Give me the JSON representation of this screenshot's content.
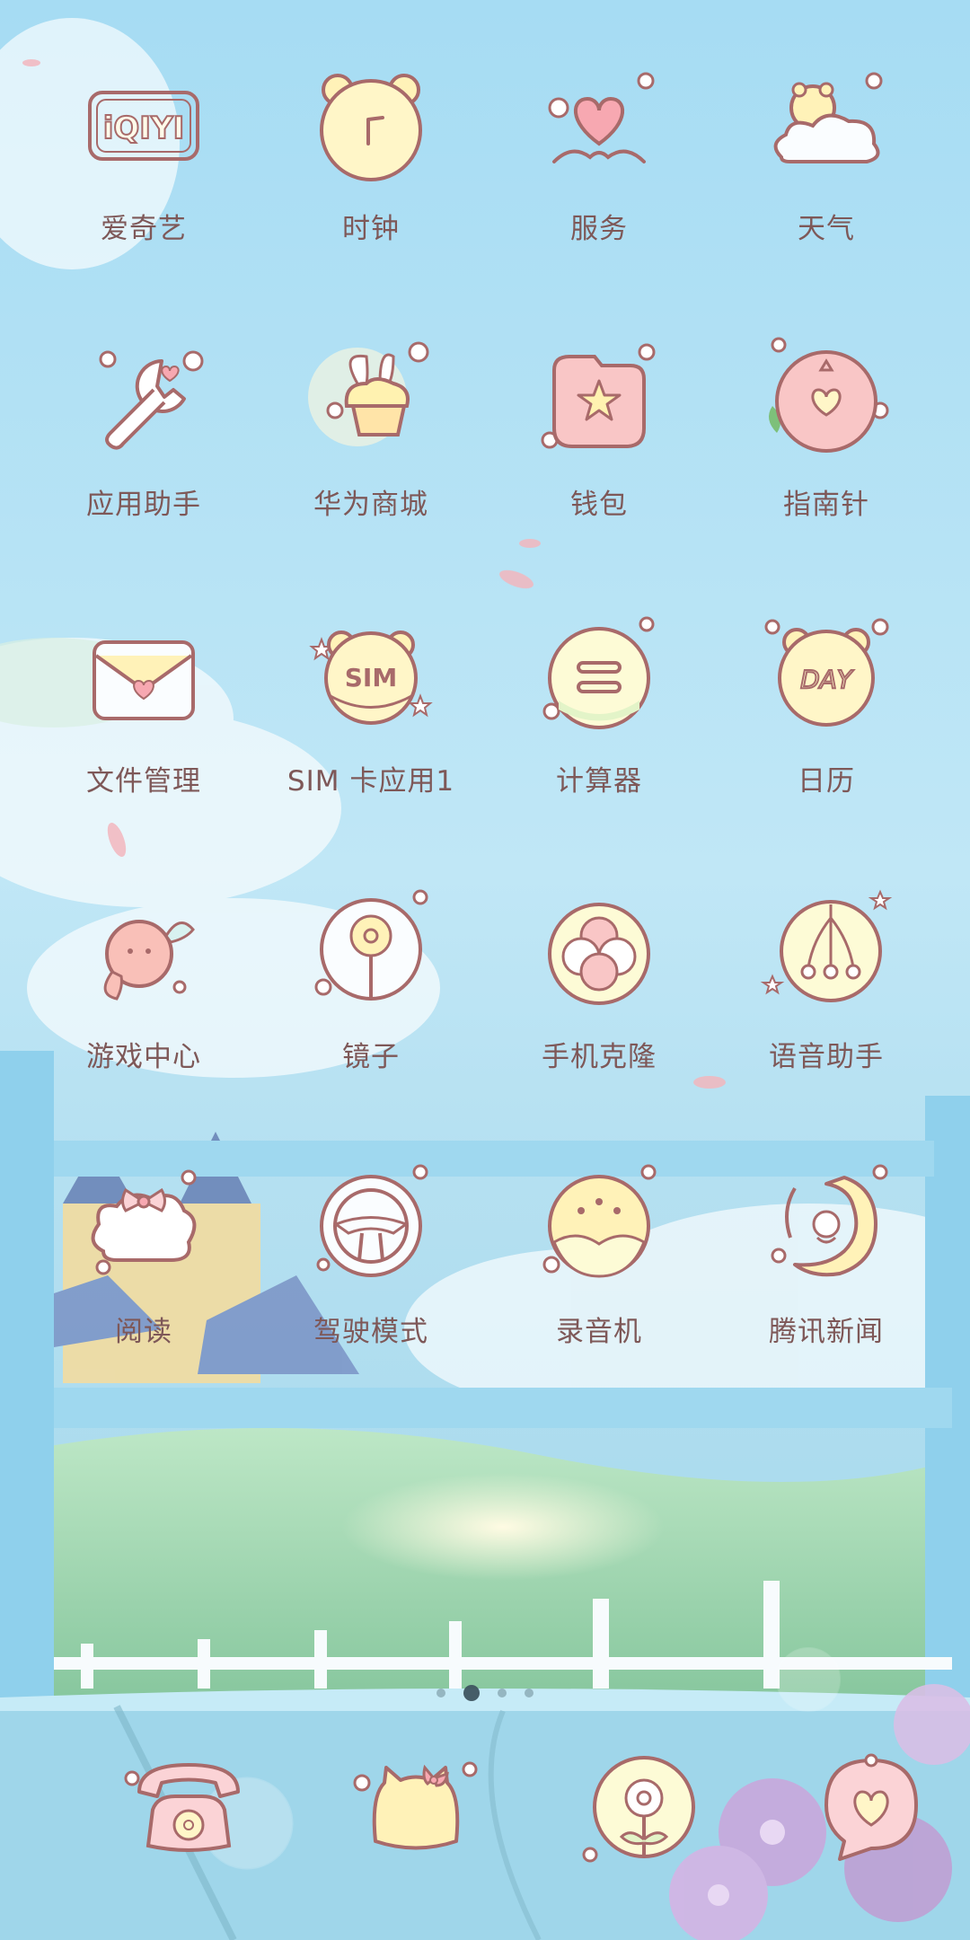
{
  "apps": [
    {
      "name": "爱奇艺",
      "icon": "iqiyi-logo-icon",
      "logo_text": "iQIYI"
    },
    {
      "name": "时钟",
      "icon": "bear-clock-icon"
    },
    {
      "name": "服务",
      "icon": "heart-service-icon"
    },
    {
      "name": "天气",
      "icon": "bear-cloud-weather-icon"
    },
    {
      "name": "应用助手",
      "icon": "wrench-heart-icon"
    },
    {
      "name": "华为商城",
      "icon": "bunny-cupcake-icon"
    },
    {
      "name": "钱包",
      "icon": "star-wallet-icon"
    },
    {
      "name": "指南针",
      "icon": "compass-heart-icon"
    },
    {
      "name": "文件管理",
      "icon": "heart-envelope-icon"
    },
    {
      "name": "SIM 卡应用1",
      "icon": "bear-sim-icon",
      "badge_text": "SIM"
    },
    {
      "name": "计算器",
      "icon": "equals-calculator-icon"
    },
    {
      "name": "日历",
      "icon": "bear-day-calendar-icon",
      "badge_text": "DAY"
    },
    {
      "name": "游戏中心",
      "icon": "candy-game-icon"
    },
    {
      "name": "镜子",
      "icon": "mirror-icon"
    },
    {
      "name": "手机克隆",
      "icon": "flower-clone-icon"
    },
    {
      "name": "语音助手",
      "icon": "cherry-voice-icon"
    },
    {
      "name": "阅读",
      "icon": "bow-cloud-read-icon"
    },
    {
      "name": "驾驶模式",
      "icon": "steering-wheel-icon"
    },
    {
      "name": "录音机",
      "icon": "recorder-icon"
    },
    {
      "name": "腾讯新闻",
      "icon": "penguin-news-icon"
    }
  ],
  "page_indicator": {
    "count": 4,
    "active_index": 1
  },
  "dock": [
    {
      "icon": "telephone-icon"
    },
    {
      "icon": "kitty-message-icon"
    },
    {
      "icon": "flower-browser-icon"
    },
    {
      "icon": "heart-bubble-camera-icon"
    }
  ],
  "colors": {
    "sky": "#a9dcf2",
    "label": "#7e5858",
    "icon_outline": "#a86a6a",
    "cream": "#fff6c8",
    "pink": "#f9c6c6"
  }
}
